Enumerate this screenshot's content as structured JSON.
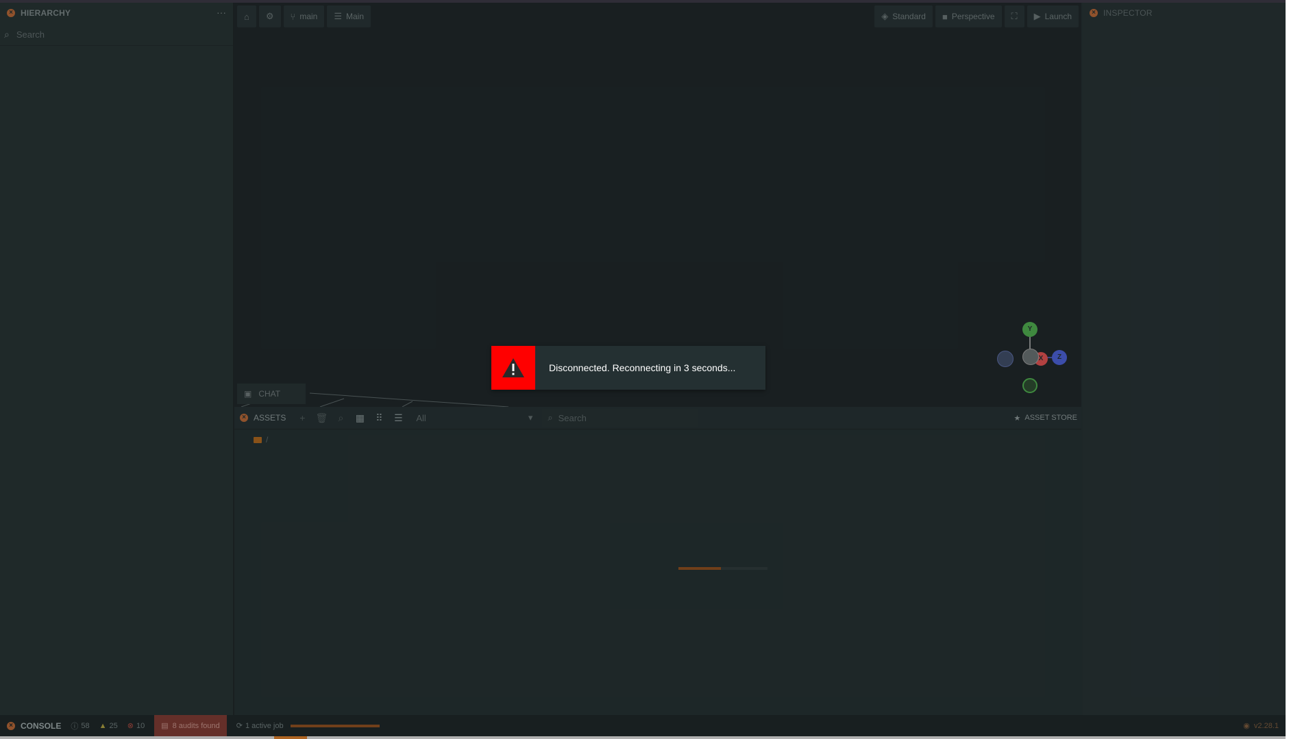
{
  "hierarchy": {
    "title": "HIERARCHY",
    "search_placeholder": "Search",
    "more_label": "···"
  },
  "scene": {
    "branch": "main",
    "scene_name": "Main",
    "shading": "Standard",
    "camera": "Perspective",
    "launch": "Launch",
    "chat": "CHAT",
    "gizmo": {
      "y": "Y",
      "z": "Z",
      "x": "X"
    }
  },
  "assets": {
    "title": "ASSETS",
    "filter": "All",
    "search_placeholder": "Search",
    "store": "ASSET STORE",
    "root_path": "/"
  },
  "inspector": {
    "title": "INSPECTOR"
  },
  "console": {
    "title": "CONSOLE",
    "info_count": "58",
    "warn_count": "25",
    "error_count": "10",
    "audits": "8 audits found",
    "jobs": "1 active job",
    "version": "v2.28.1"
  },
  "toast": {
    "message": "Disconnected. Reconnecting in 3 seconds..."
  },
  "colors": {
    "accent": "#b06536",
    "alert": "#ff0000",
    "gizmo_x": "#e05555",
    "gizmo_y": "#4ea84e",
    "gizmo_z": "#4a5fd0"
  }
}
